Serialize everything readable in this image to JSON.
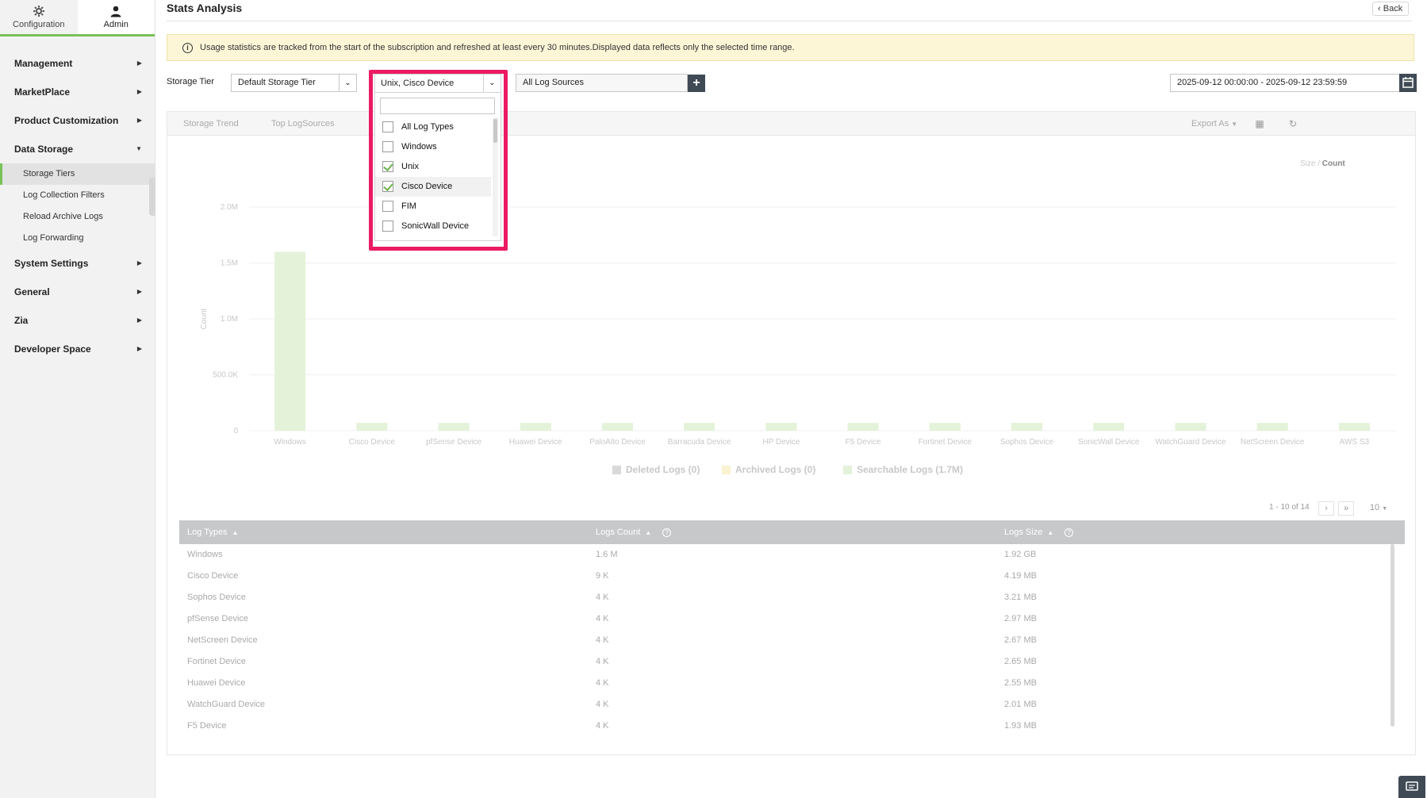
{
  "topnav": {
    "configuration": "Configuration",
    "admin": "Admin"
  },
  "sidebar": {
    "items": [
      {
        "label": "Management"
      },
      {
        "label": "MarketPlace"
      },
      {
        "label": "Product Customization"
      },
      {
        "label": "Data Storage"
      },
      {
        "label": "System Settings"
      },
      {
        "label": "General"
      },
      {
        "label": "Zia"
      },
      {
        "label": "Developer Space"
      }
    ],
    "data_storage_sub": [
      "Storage Tiers",
      "Log Collection Filters",
      "Reload Archive Logs",
      "Log Forwarding"
    ],
    "active_sub": "Storage Tiers"
  },
  "header": {
    "title": "Stats Analysis",
    "back": "Back"
  },
  "notice": "Usage statistics are tracked from the start of the subscription and refreshed at least every 30 minutes.Displayed data reflects only the selected time range.",
  "filters": {
    "storage_tier_label": "Storage Tier",
    "storage_tier_value": "Default Storage Tier",
    "log_type_value": "Unix, Cisco Device",
    "log_sources_value": "All Log Sources",
    "date_range": "2025-09-12 00:00:00 - 2025-09-12 23:59:59"
  },
  "dropdown": {
    "search_placeholder": "",
    "options": [
      {
        "label": "All Log Types",
        "checked": false
      },
      {
        "label": "Windows",
        "checked": false
      },
      {
        "label": "Unix",
        "checked": true
      },
      {
        "label": "Cisco Device",
        "checked": true
      },
      {
        "label": "FIM",
        "checked": false
      },
      {
        "label": "SonicWall Device",
        "checked": false
      }
    ]
  },
  "tabs": [
    "Storage Trend",
    "Top LogSources"
  ],
  "toolbar": {
    "export": "Export As"
  },
  "toggle": {
    "size": "Size",
    "sep": " / ",
    "count": "Count"
  },
  "chart_data": {
    "type": "bar",
    "ylabel": "Count",
    "ylim": [
      0,
      2000000
    ],
    "yticks": [
      "0",
      "500.0K",
      "1.0M",
      "1.5M",
      "2.0M"
    ],
    "categories": [
      "Windows",
      "Cisco Device",
      "pfSense Device",
      "Huawei Device",
      "PaloAlto Device",
      "Barracuda Device",
      "HP Device",
      "F5 Device",
      "Fortinet Device",
      "Sophos Device",
      "SonicWall Device",
      "WatchGuard Device",
      "NetScreen Device",
      "AWS S3"
    ],
    "series": [
      {
        "name": "Deleted Logs (0)",
        "color": "#d9d9d9",
        "values": [
          0,
          0,
          0,
          0,
          0,
          0,
          0,
          0,
          0,
          0,
          0,
          0,
          0,
          0
        ]
      },
      {
        "name": "Archived Logs (0)",
        "color": "#faf3d1",
        "values": [
          0,
          0,
          0,
          0,
          0,
          0,
          0,
          0,
          0,
          0,
          0,
          0,
          0,
          0
        ]
      },
      {
        "name": "Searchable Logs (1.7M)",
        "color": "#e4f2d9",
        "values": [
          1600000,
          70000,
          70000,
          70000,
          70000,
          70000,
          70000,
          70000,
          70000,
          70000,
          70000,
          70000,
          70000,
          70000
        ]
      }
    ],
    "legend": "bottom"
  },
  "pager": {
    "range": "1 - 10 of 14",
    "per_page": "10"
  },
  "table": {
    "headers": [
      "Log Types",
      "Logs Count",
      "Logs Size"
    ],
    "rows": [
      [
        "Windows",
        "1.6 M",
        "1.92 GB"
      ],
      [
        "Cisco Device",
        "9 K",
        "4.19 MB"
      ],
      [
        "Sophos Device",
        "4 K",
        "3.21 MB"
      ],
      [
        "pfSense Device",
        "4 K",
        "2.97 MB"
      ],
      [
        "NetScreen Device",
        "4 K",
        "2.67 MB"
      ],
      [
        "Fortinet Device",
        "4 K",
        "2.65 MB"
      ],
      [
        "Huawei Device",
        "4 K",
        "2.55 MB"
      ],
      [
        "WatchGuard Device",
        "4 K",
        "2.01 MB"
      ],
      [
        "F5 Device",
        "4 K",
        "1.93 MB"
      ]
    ]
  }
}
